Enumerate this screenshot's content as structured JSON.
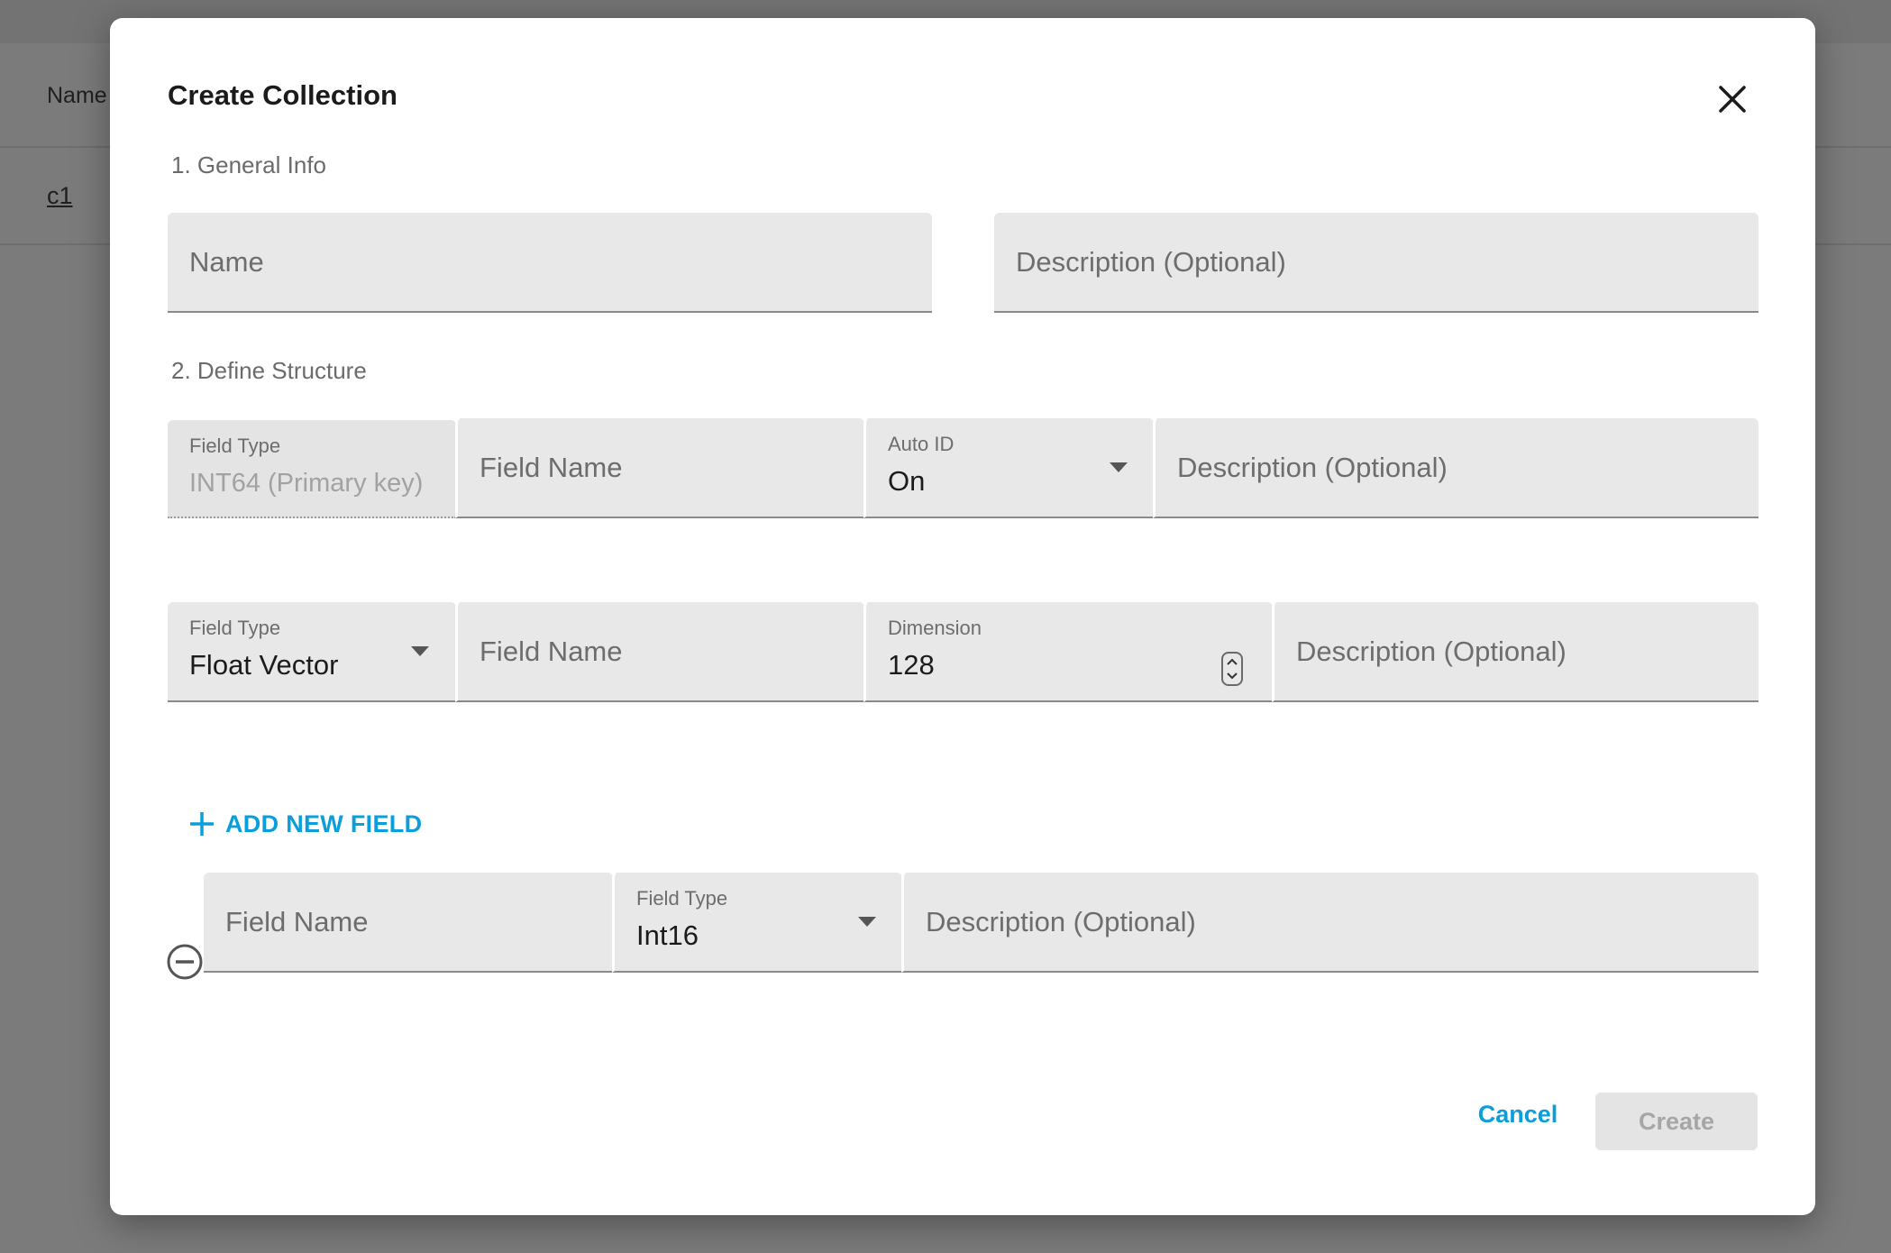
{
  "background": {
    "table_header": "Name",
    "row_link": "c1"
  },
  "dialog": {
    "title": "Create Collection",
    "close_icon": "close-icon",
    "section_general": "1. General Info",
    "name_placeholder": "Name",
    "description_placeholder": "Description (Optional)",
    "section_structure": "2. Define Structure",
    "primary_field": {
      "type_label": "Field Type",
      "type_value": "INT64 (Primary key)",
      "name_placeholder": "Field Name",
      "auto_id_label": "Auto ID",
      "auto_id_value": "On",
      "description_placeholder": "Description (Optional)"
    },
    "vector_field": {
      "type_label": "Field Type",
      "type_value": "Float Vector",
      "name_placeholder": "Field Name",
      "dimension_label": "Dimension",
      "dimension_value": "128",
      "description_placeholder": "Description (Optional)"
    },
    "add_field_label": "ADD NEW FIELD",
    "extra_field": {
      "name_placeholder": "Field Name",
      "type_label": "Field Type",
      "type_value": "Int16",
      "description_placeholder": "Description (Optional)"
    },
    "cancel_label": "Cancel",
    "create_label": "Create"
  },
  "colors": {
    "accent": "#0b9edc",
    "field_bg": "#e8e8e8",
    "overlay": "#7b7b7b"
  }
}
